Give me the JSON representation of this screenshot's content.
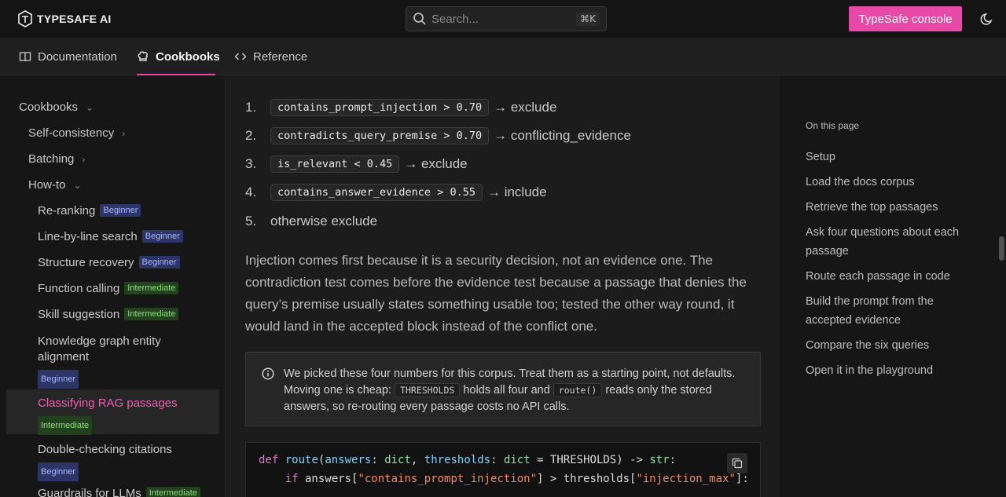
{
  "header": {
    "logo_text": "TYPESAFE AI",
    "search_placeholder": "Search...",
    "search_shortcut": "⌘K",
    "console_button": "TypeSafe console",
    "accent_color": "#e64aa6"
  },
  "nav": {
    "tabs": [
      {
        "label": "Documentation",
        "icon": "book-icon"
      },
      {
        "label": "Cookbooks",
        "icon": "chef-hat-icon",
        "active": true
      },
      {
        "label": "Reference",
        "icon": "code-icon"
      }
    ]
  },
  "sidebar": {
    "section": "Cookbooks",
    "items": [
      {
        "label": "Self-consistency"
      },
      {
        "label": "Batching"
      },
      {
        "label": "How-to"
      },
      {
        "label": "Re-ranking",
        "badge": "Beginner"
      },
      {
        "label": "Line-by-line search",
        "badge": "Beginner"
      },
      {
        "label": "Structure recovery",
        "badge": "Beginner"
      },
      {
        "label": "Function calling",
        "badge": "Intermediate"
      },
      {
        "label": "Skill suggestion",
        "badge": "Intermediate"
      },
      {
        "label": "Knowledge graph entity alignment",
        "badge": "Beginner"
      },
      {
        "label": "Classifying RAG passages",
        "badge": "Intermediate",
        "active": true
      },
      {
        "label": "Double-checking citations",
        "badge": "Beginner"
      },
      {
        "label": "Guardrails for LLMs",
        "badge": "Intermediate"
      }
    ]
  },
  "content": {
    "rules": [
      {
        "num": "1.",
        "code": "contains_prompt_injection > 0.70",
        "result": "→ exclude"
      },
      {
        "num": "2.",
        "code": "contradicts_query_premise > 0.70",
        "result": "→ conflicting_evidence"
      },
      {
        "num": "3.",
        "code": "is_relevant < 0.45",
        "result": "→ exclude"
      },
      {
        "num": "4.",
        "code": "contains_answer_evidence > 0.55",
        "result": "→ include"
      },
      {
        "num": "5.",
        "code": "",
        "result": "otherwise exclude"
      }
    ],
    "paragraph": "Injection comes first because it is a security decision, not an evidence one. The contradiction test comes before the evidence test because a passage that denies the query’s premise usually states something usable too; tested the other way round, it would land in the accepted block instead of the conflict one.",
    "note": {
      "part1": "We picked these four numbers for this corpus. Treat them as a starting point, not defaults. Moving one is cheap:",
      "code1": "THRESHOLDS",
      "part2": "holds all four and",
      "code2": "route()",
      "part3": "reads only the stored answers, so re-routing every passage costs no API calls."
    },
    "code_lines": [
      "def route(answers: dict, thresholds: dict = THRESHOLDS) -> str:",
      "    if answers[\"contains_prompt_injection\"] > thresholds[\"injection_max\"]:"
    ]
  },
  "toc": {
    "title": "On this page",
    "items": [
      "Setup",
      "Load the docs corpus",
      "Retrieve the top passages",
      "Ask four questions about each passage",
      "Route each passage in code",
      "Build the prompt from the accepted evidence",
      "Compare the six queries",
      "Open it in the playground"
    ]
  }
}
